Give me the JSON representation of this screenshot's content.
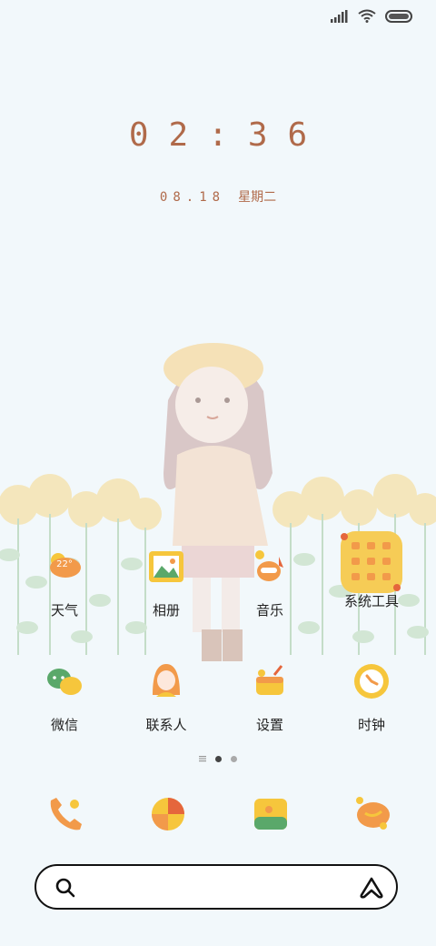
{
  "status_bar": {
    "icons": [
      "signal-icon",
      "wifi-icon",
      "battery-icon"
    ]
  },
  "lock": {
    "time": "02:36",
    "date": "08.18",
    "weekday": "星期二"
  },
  "weather": {
    "temp": "22°"
  },
  "apps": [
    {
      "label": "天气",
      "icon": "weather-icon"
    },
    {
      "label": "相册",
      "icon": "gallery-icon"
    },
    {
      "label": "音乐",
      "icon": "music-icon"
    },
    {
      "label": "系统工具",
      "icon": "system-tools-folder-icon"
    },
    {
      "label": "微信",
      "icon": "wechat-icon"
    },
    {
      "label": "联系人",
      "icon": "contacts-icon"
    },
    {
      "label": "设置",
      "icon": "settings-icon"
    },
    {
      "label": "时钟",
      "icon": "clock-icon"
    }
  ],
  "dock": [
    "phone-icon",
    "browser-icon",
    "messages-icon",
    "camera-icon"
  ],
  "search_bar": {
    "icons": [
      "search-icon",
      "assistant-icon"
    ]
  },
  "colors": {
    "accent": "#b06a4a",
    "background": "#f2f8fb",
    "orange": "#f29a4a",
    "yellow": "#f6c63c"
  }
}
